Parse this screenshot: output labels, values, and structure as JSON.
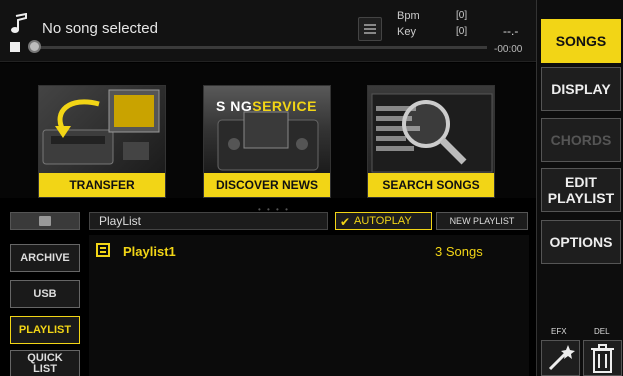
{
  "player": {
    "song_title": "No song selected",
    "bpm_label": "Bpm",
    "key_label": "Key",
    "bpm_value": "[0]",
    "key_value": "[0]",
    "time_elapsed": "--.-",
    "time_remaining": "-00:00",
    "progress": 0
  },
  "banners": [
    {
      "label": "TRANSFER"
    },
    {
      "label": "DISCOVER NEWS",
      "logo_prefix": "S NG",
      "logo_suffix": "SERVICE"
    },
    {
      "label": "SEARCH SONGS"
    }
  ],
  "playlist_bar": {
    "name": "PlayList",
    "autoplay_label": "AUTOPLAY",
    "autoplay_checked": true,
    "new_playlist_label": "NEW PLAYLIST"
  },
  "left_nav": [
    {
      "label": "ARCHIVE"
    },
    {
      "label": "USB"
    },
    {
      "label": "PLAYLIST",
      "active": true
    },
    {
      "label": "QUICK LIST",
      "line1": "QUICK",
      "line2": "LIST"
    }
  ],
  "list": [
    {
      "name": "Playlist1",
      "count": "3 Songs"
    }
  ],
  "right_panel": {
    "songs": "SONGS",
    "display": "DISPLAY",
    "chords": "CHORDS",
    "edit_line1": "EDIT",
    "edit_line2": "PLAYLIST",
    "options": "OPTIONS",
    "efx_label": "EFX",
    "del_label": "DEL"
  },
  "colors": {
    "accent": "#f2d516",
    "background": "#000000",
    "panel": "#1e1e1e"
  },
  "icons": [
    "music-note-icon",
    "list-icon",
    "folder-icon",
    "checkmark-icon",
    "playlist-icon",
    "magic-wand-icon",
    "trash-icon"
  ]
}
